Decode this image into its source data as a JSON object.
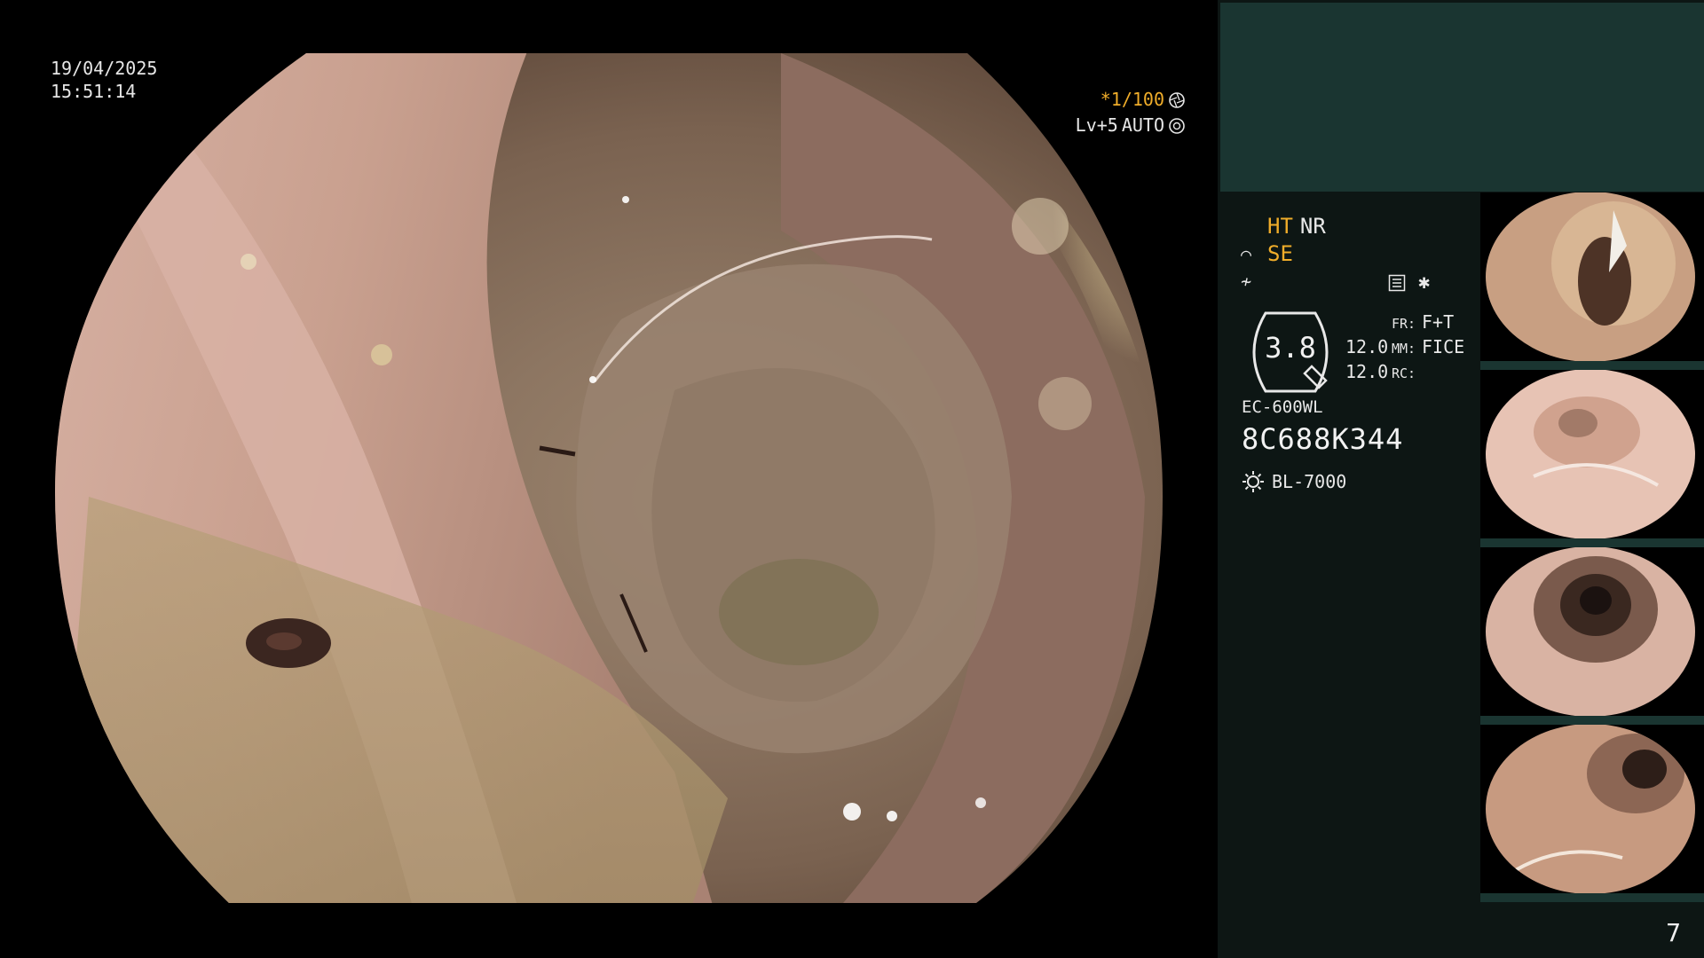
{
  "overlay": {
    "date": "19/04/2025",
    "time": "15:51:14",
    "shutter": "*1/100",
    "level": "Lv+5",
    "auto": "AUTO"
  },
  "status": {
    "ht": "HT",
    "nr": "NR",
    "se": "SE",
    "zoom": "3.8",
    "fr_label": "FR:",
    "fr_value": "F+T",
    "mm_value": "12.0",
    "mm_label": "MM:",
    "mm_mode": "FICE",
    "rc_value": "12.0",
    "rc_label": "RC:",
    "scope_model": "EC-600WL",
    "serial": "8C688K344",
    "light_source": "BL-7000",
    "page": "7"
  },
  "thumbnails": [
    {
      "name": "thumbnail-1"
    },
    {
      "name": "thumbnail-2"
    },
    {
      "name": "thumbnail-3"
    },
    {
      "name": "thumbnail-4"
    }
  ],
  "colors": {
    "accent": "#f0ad2a",
    "panel_band": "#1a3531",
    "panel_bg": "#0d1614"
  }
}
